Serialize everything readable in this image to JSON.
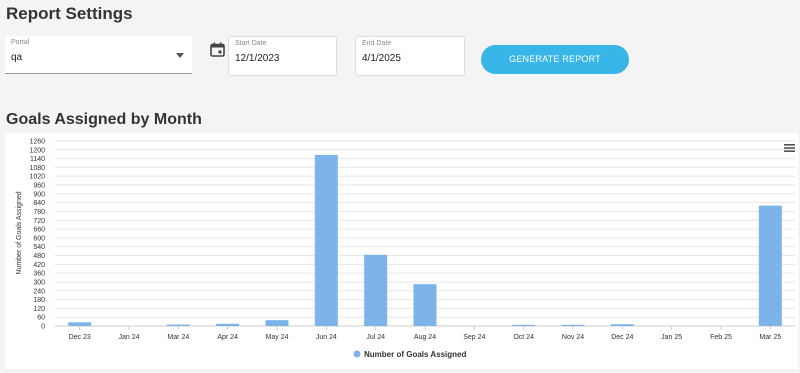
{
  "header": {
    "title": "Report Settings"
  },
  "filters": {
    "portal": {
      "label": "Portal",
      "value": "qa"
    },
    "start": {
      "label": "Start Date",
      "value": "12/1/2023"
    },
    "end": {
      "label": "End Date",
      "value": "4/1/2025"
    },
    "generate_label": "GENERATE REPORT"
  },
  "chart_section": {
    "title": "Goals Assigned by Month"
  },
  "colors": {
    "bar": "#7cb4ea",
    "button": "#38b6e8"
  },
  "chart_data": {
    "type": "bar",
    "categories": [
      "Dec 23",
      "Jan 24",
      "Mar 24",
      "Apr 24",
      "May 24",
      "Jun 24",
      "Jul 24",
      "Aug 24",
      "Sep 24",
      "Oct 24",
      "Nov 24",
      "Dec 24",
      "Jan 25",
      "Feb 25",
      "Mar 25"
    ],
    "series": [
      {
        "name": "Number of Goals Assigned",
        "values": [
          25,
          0,
          10,
          15,
          40,
          1165,
          485,
          285,
          0,
          8,
          8,
          12,
          0,
          0,
          820
        ]
      }
    ],
    "ylabel": "Number of Goals Assigned",
    "ylim": [
      0,
      1260
    ],
    "yticks": [
      "0",
      "60",
      "120",
      "180",
      "240",
      "300",
      "360",
      "420",
      "480",
      "540",
      "600",
      "660",
      "720",
      "780",
      "840",
      "900",
      "960",
      "1020",
      "1080",
      "1140",
      "1200",
      "1260"
    ],
    "grid": true,
    "legend": "bottom-center"
  }
}
